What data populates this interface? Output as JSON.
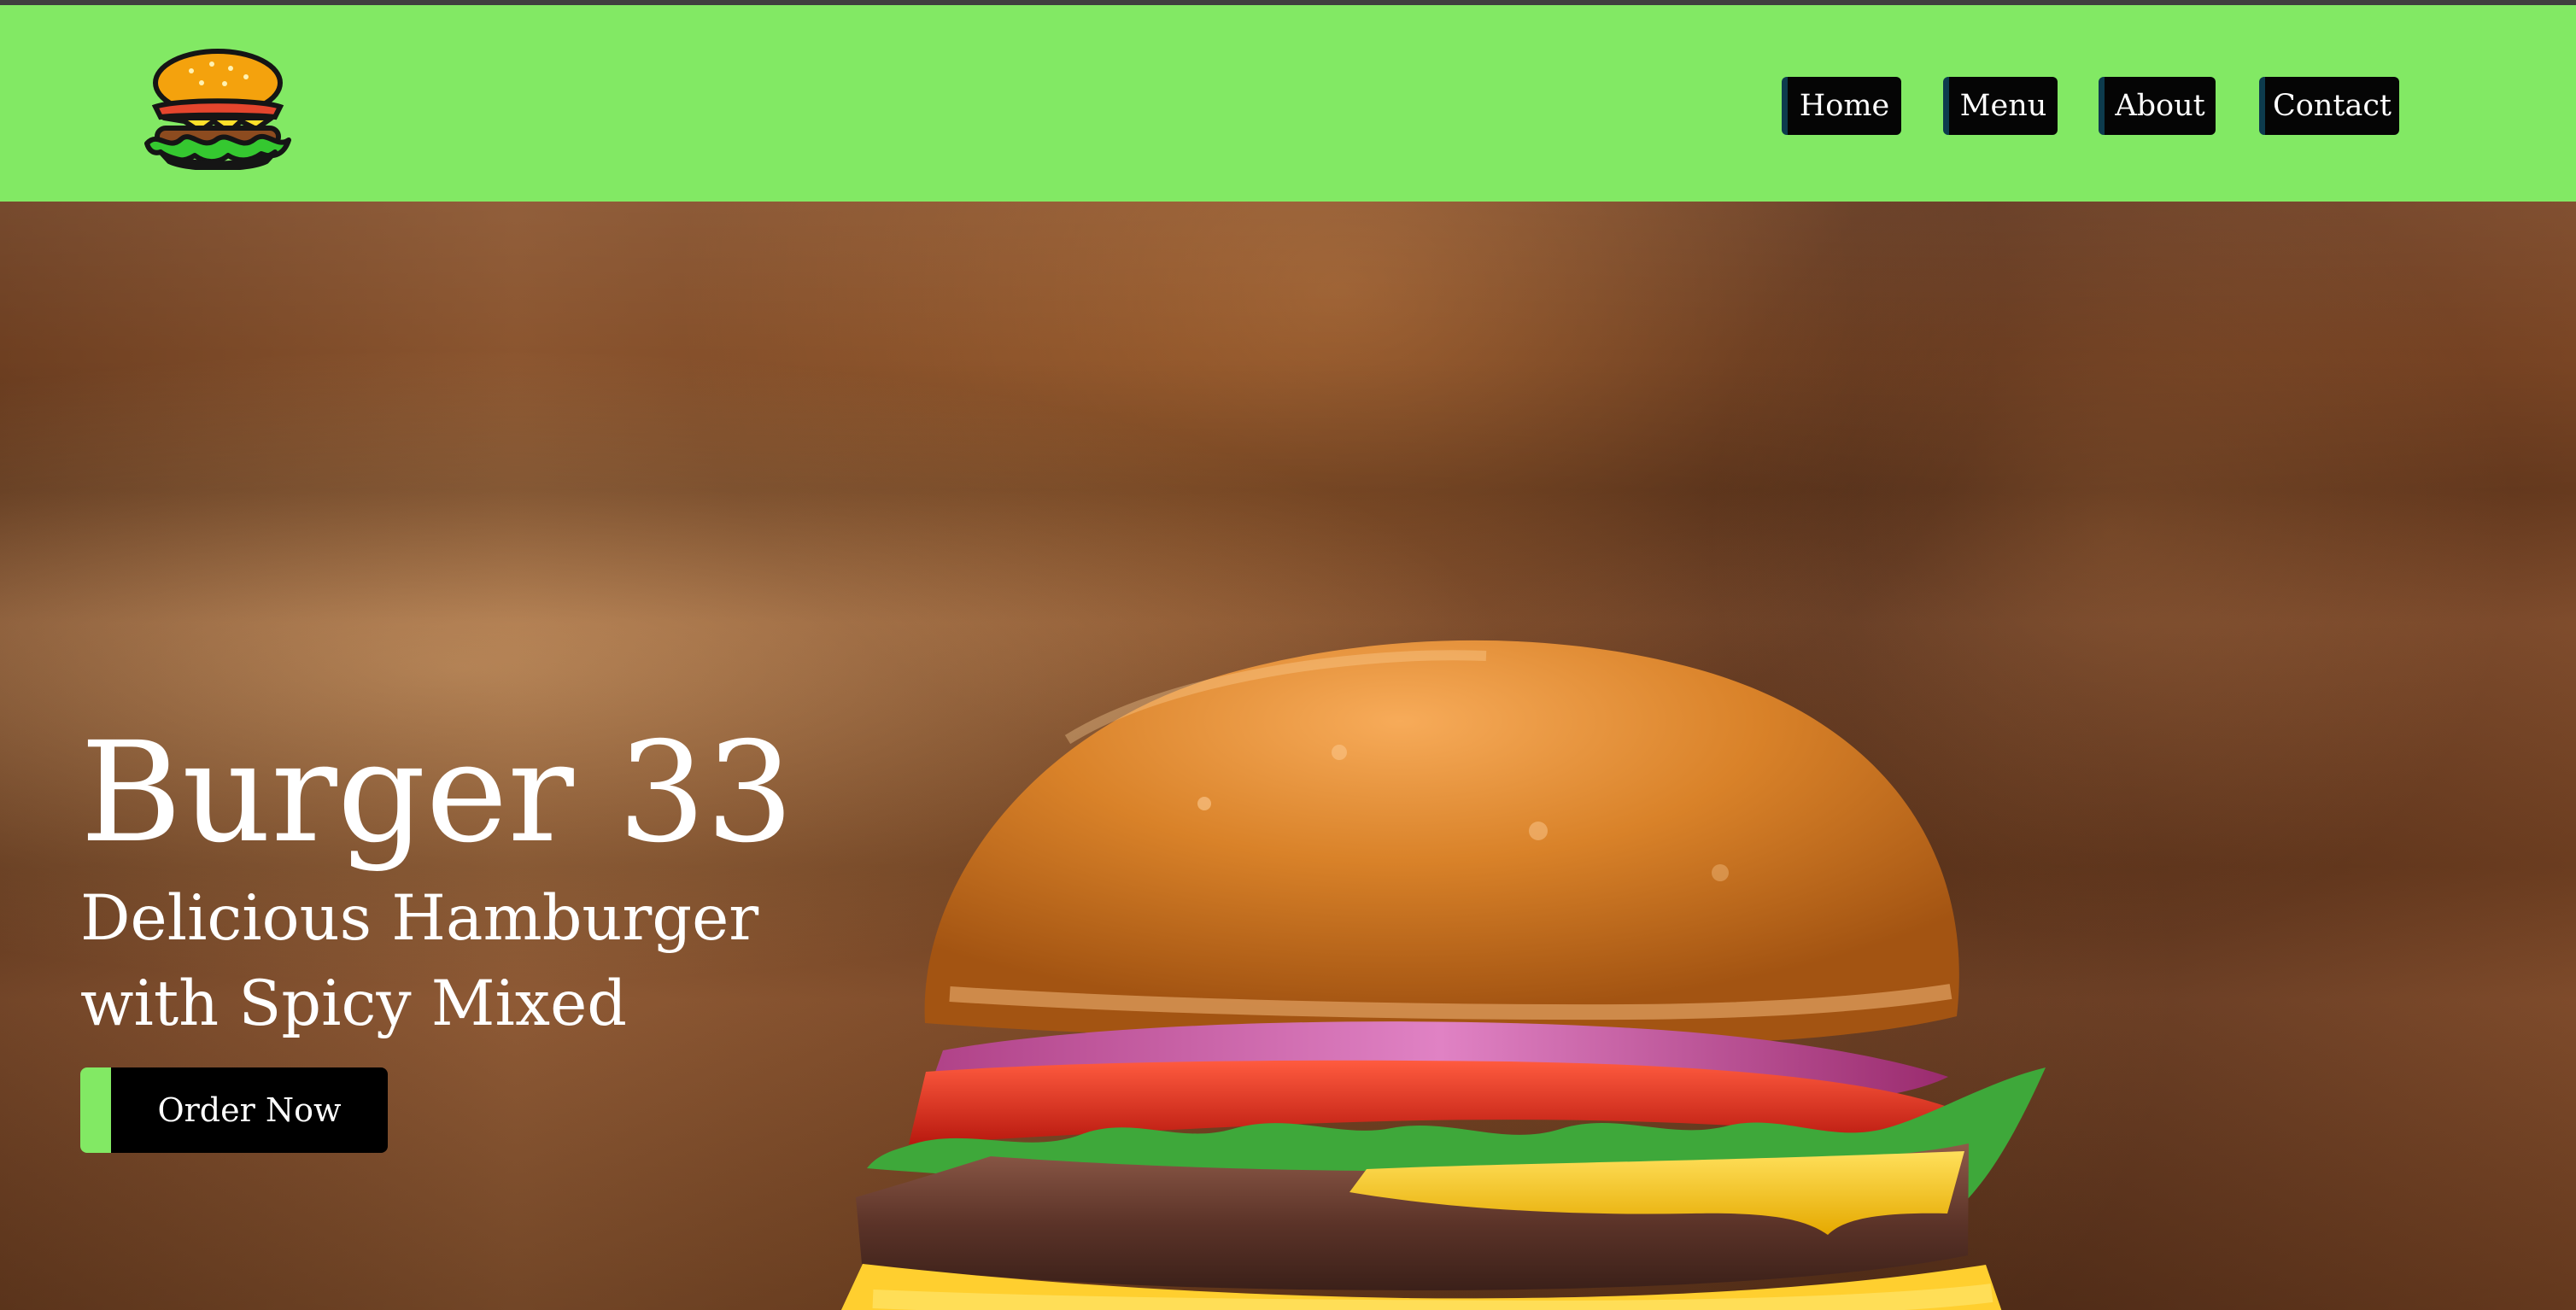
{
  "brand": {
    "logo_icon": "burger-logo-icon"
  },
  "nav": {
    "items": [
      {
        "label": "Home"
      },
      {
        "label": "Menu"
      },
      {
        "label": "About"
      },
      {
        "label": "Contact"
      }
    ]
  },
  "hero": {
    "title": "Burger 33",
    "subtitle": "Delicious Hamburger with Spicy Mixed",
    "cta_label": "Order Now"
  },
  "colors": {
    "header_green": "#82e964",
    "button_black": "#050505",
    "text_white": "#ffffff"
  }
}
